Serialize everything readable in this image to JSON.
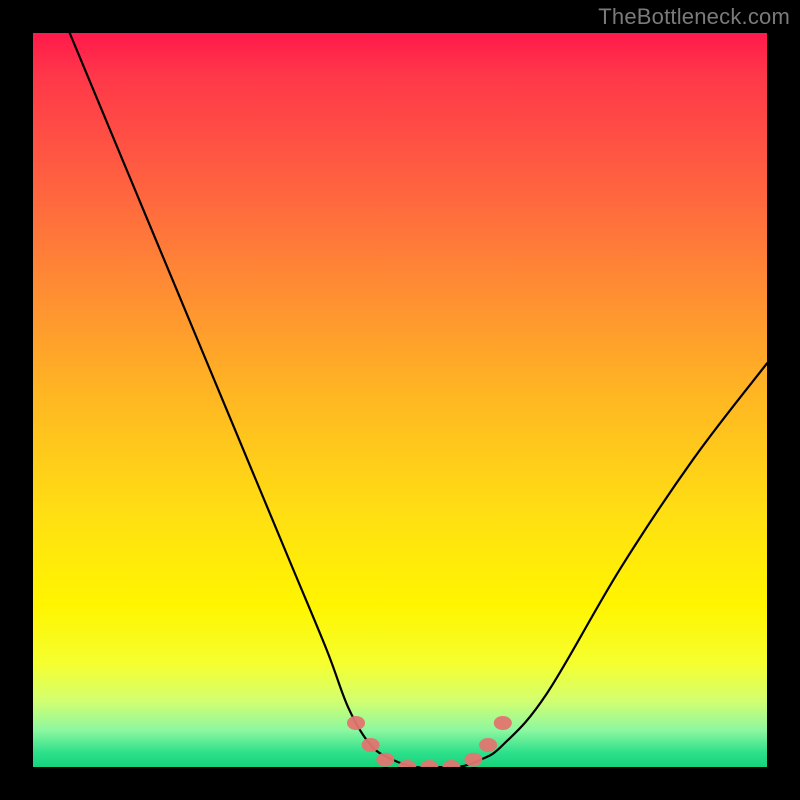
{
  "watermark": "TheBottleneck.com",
  "chart_data": {
    "type": "line",
    "title": "",
    "xlabel": "",
    "ylabel": "",
    "xlim": [
      0,
      100
    ],
    "ylim": [
      0,
      100
    ],
    "grid": false,
    "legend": false,
    "background_gradient": {
      "stops": [
        {
          "pos": 0,
          "color": "#ff1a4b"
        },
        {
          "pos": 18,
          "color": "#ff5a42"
        },
        {
          "pos": 50,
          "color": "#ffb822"
        },
        {
          "pos": 78,
          "color": "#fff500"
        },
        {
          "pos": 95,
          "color": "#8cf7a0"
        },
        {
          "pos": 100,
          "color": "#14d47c"
        }
      ]
    },
    "series": [
      {
        "name": "bottleneck-curve",
        "color": "#000000",
        "x": [
          5,
          10,
          15,
          20,
          25,
          30,
          35,
          40,
          43,
          46,
          49,
          52,
          55,
          58,
          61,
          64,
          70,
          80,
          90,
          100
        ],
        "y": [
          100,
          88,
          76,
          64,
          52,
          40,
          28,
          16,
          8,
          3,
          1,
          0,
          0,
          0,
          1,
          3,
          10,
          27,
          42,
          55
        ]
      }
    ],
    "markers": [
      {
        "name": "left-knee-1",
        "x": 44,
        "y": 6,
        "color": "#e27570"
      },
      {
        "name": "left-knee-2",
        "x": 46,
        "y": 3,
        "color": "#e27570"
      },
      {
        "name": "left-knee-3",
        "x": 48,
        "y": 1,
        "color": "#e27570"
      },
      {
        "name": "flat-1",
        "x": 51,
        "y": 0,
        "color": "#e27570"
      },
      {
        "name": "flat-2",
        "x": 54,
        "y": 0,
        "color": "#e27570"
      },
      {
        "name": "flat-3",
        "x": 57,
        "y": 0,
        "color": "#e27570"
      },
      {
        "name": "right-knee-1",
        "x": 60,
        "y": 1,
        "color": "#e27570"
      },
      {
        "name": "right-knee-2",
        "x": 62,
        "y": 3,
        "color": "#e27570"
      },
      {
        "name": "right-knee-3",
        "x": 64,
        "y": 6,
        "color": "#e27570"
      }
    ]
  }
}
